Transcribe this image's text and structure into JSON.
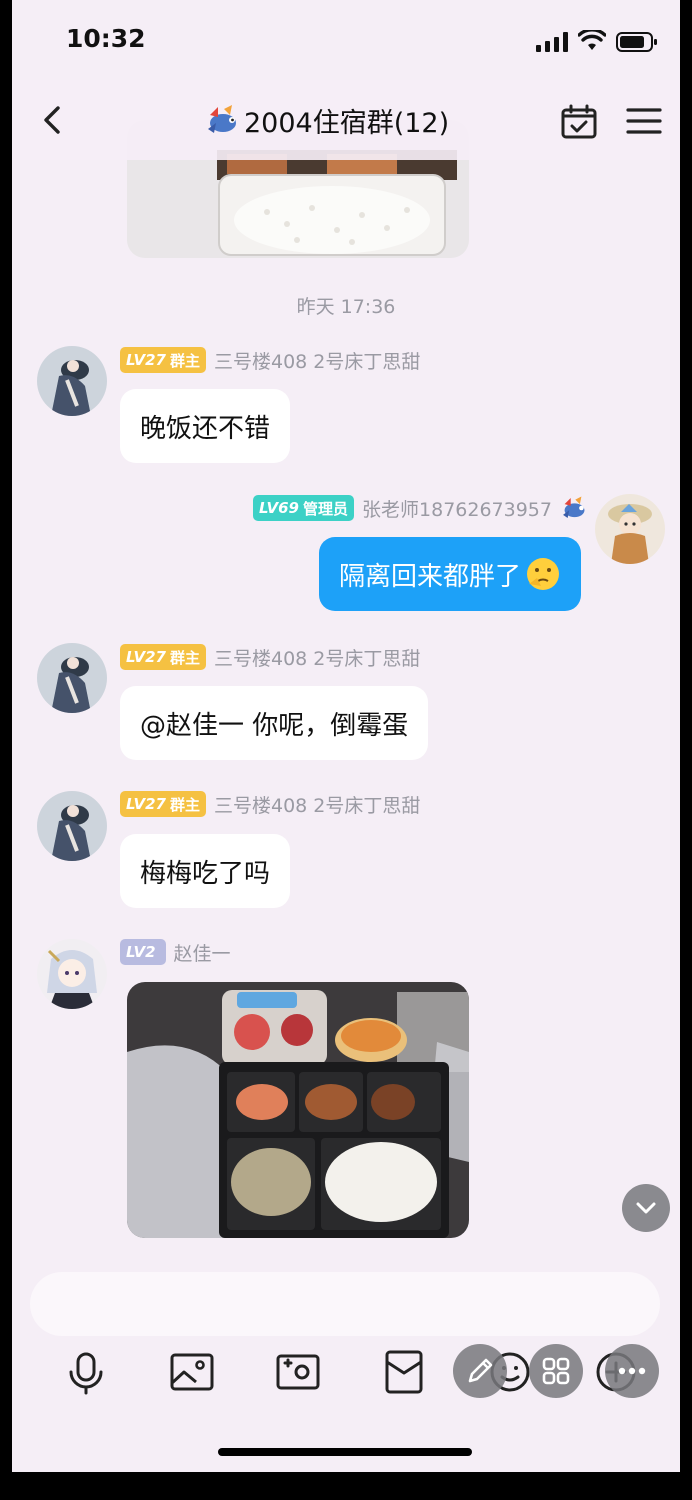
{
  "status_bar": {
    "time": "10:32"
  },
  "header": {
    "title": "2004住宿群(12)"
  },
  "chat": {
    "time_separator": "昨天 17:36",
    "messages": [
      {
        "badge_level": "LV27",
        "badge_role": "群主",
        "sender": "三号楼408 2号床丁思甜",
        "text": "晚饭还不错"
      },
      {
        "badge_level": "LV69",
        "badge_role": "管理员",
        "sender": "张老师18762673957",
        "text": "隔离回来都胖了"
      },
      {
        "badge_level": "LV27",
        "badge_role": "群主",
        "sender": "三号楼408 2号床丁思甜",
        "text": "@赵佳一 你呢，倒霉蛋"
      },
      {
        "badge_level": "LV27",
        "badge_role": "群主",
        "sender": "三号楼408 2号床丁思甜",
        "text": "梅梅吃了吗"
      },
      {
        "badge_level": "LV2",
        "sender": "赵佳一"
      }
    ]
  },
  "toolbar": {
    "items": [
      "mic-icon",
      "image-icon",
      "camera-icon",
      "red-packet-icon",
      "emoji-icon",
      "plus-icon"
    ]
  },
  "colors": {
    "accent_blue": "#1da1f8",
    "owner_badge": "#f5c142",
    "admin_badge": "#3cd1c6",
    "background": "#f5eef6"
  }
}
